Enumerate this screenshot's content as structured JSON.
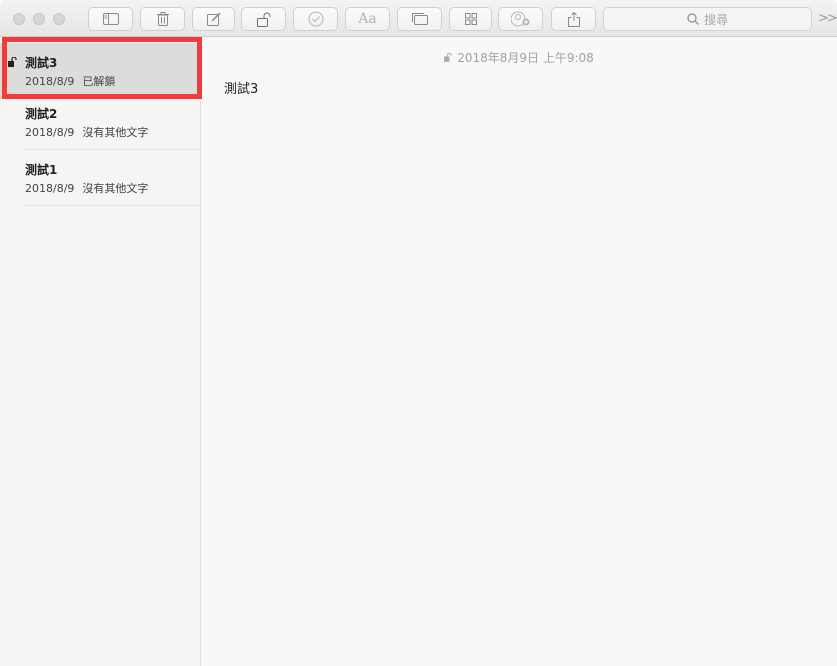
{
  "toolbar": {
    "buttons": [
      "sidebar-toggle-icon",
      "trash-icon",
      "compose-icon",
      "lock-icon",
      "checklist-icon",
      "font-icon",
      "media-icon",
      "table-icon",
      "share-person-icon",
      "share-icon"
    ],
    "search_placeholder": "搜尋",
    "overflow": ">>"
  },
  "sidebar": {
    "items": [
      {
        "title": "測試3",
        "date": "2018/8/9",
        "preview": "已解鎖",
        "selected": true,
        "locked": true
      },
      {
        "title": "測試2",
        "date": "2018/8/9",
        "preview": "沒有其他文字",
        "selected": false,
        "locked": false
      },
      {
        "title": "測試1",
        "date": "2018/8/9",
        "preview": "沒有其他文字",
        "selected": false,
        "locked": false
      }
    ]
  },
  "editor": {
    "date": "2018年8月9日 上午9:08",
    "body": "測試3"
  },
  "colors": {
    "highlight": "#f23c3c",
    "selected_row": "#dcdcdb"
  }
}
